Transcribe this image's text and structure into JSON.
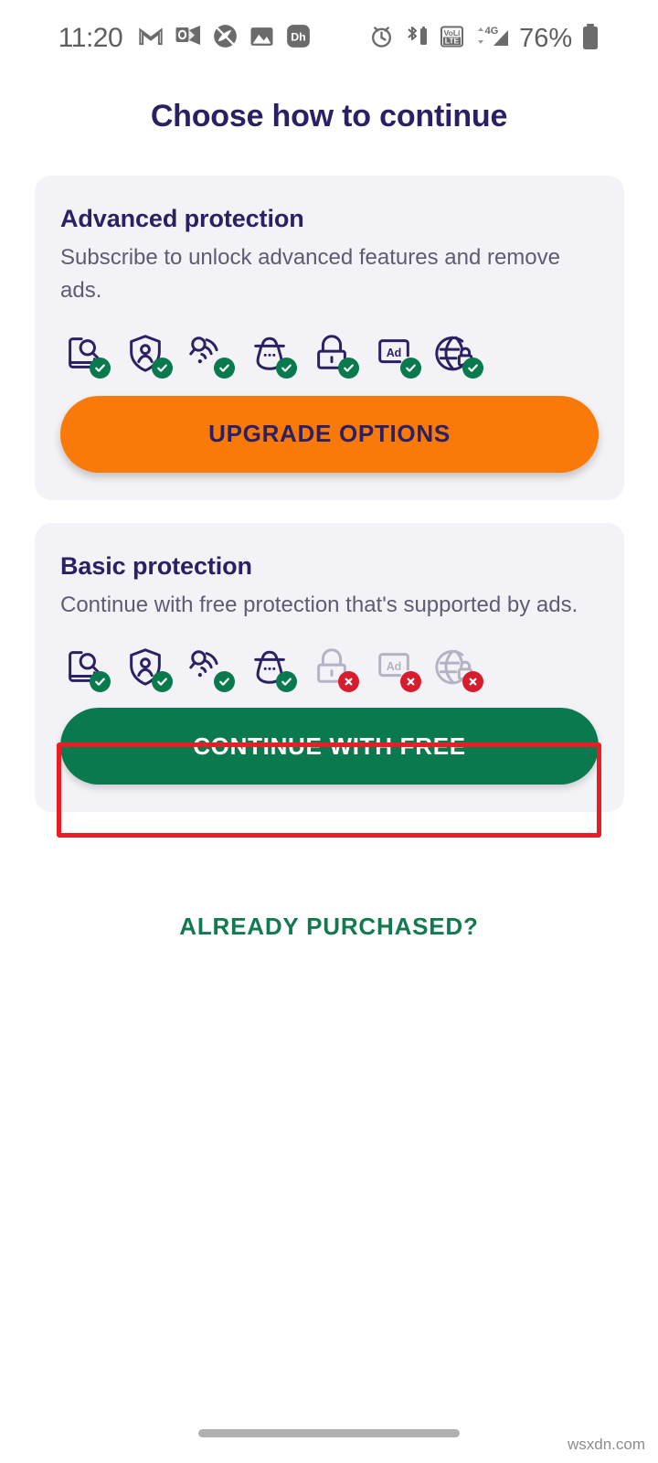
{
  "status_bar": {
    "time": "11:20",
    "battery_percent": "76%",
    "left_icons": [
      {
        "name": "gmail-icon",
        "label": "M"
      },
      {
        "name": "outlook-icon",
        "label": "Outlook"
      },
      {
        "name": "circle-app-icon",
        "label": "App"
      },
      {
        "name": "photos-icon",
        "label": "Photos"
      },
      {
        "name": "hotstar-icon",
        "label": "Dh"
      }
    ],
    "right_icons": [
      {
        "name": "alarm-icon",
        "label": "Alarm"
      },
      {
        "name": "bluetooth-battery-icon",
        "label": "Bluetooth"
      },
      {
        "name": "volte-icon",
        "label": "VoLTE"
      },
      {
        "name": "signal-4g-icon",
        "label": "4G"
      },
      {
        "name": "battery-icon",
        "label": "Battery"
      }
    ]
  },
  "header": {
    "title": "Choose how to continue"
  },
  "cards": [
    {
      "id": "advanced",
      "title": "Advanced protection",
      "description": "Subscribe to unlock advanced features and remove ads.",
      "features": [
        {
          "name": "phone-scan-icon",
          "label": "Device scan",
          "enabled": true
        },
        {
          "name": "shield-identity-icon",
          "label": "Identity protection",
          "enabled": true
        },
        {
          "name": "wifi-scan-icon",
          "label": "Wi-Fi scan",
          "enabled": true
        },
        {
          "name": "spy-detective-icon",
          "label": "Anti-spy",
          "enabled": true
        },
        {
          "name": "lock-icon",
          "label": "App lock",
          "enabled": true
        },
        {
          "name": "ad-block-icon",
          "label": "Ad removal",
          "enabled": true
        },
        {
          "name": "vpn-globe-lock-icon",
          "label": "VPN",
          "enabled": true
        }
      ],
      "button": {
        "name": "upgrade-options-button",
        "label": "UPGRADE OPTIONS",
        "color": "#F97A09",
        "text_color": "#2B2064"
      }
    },
    {
      "id": "basic",
      "title": "Basic protection",
      "description": "Continue with free protection that's supported by ads.",
      "features": [
        {
          "name": "phone-scan-icon",
          "label": "Device scan",
          "enabled": true
        },
        {
          "name": "shield-identity-icon",
          "label": "Identity protection",
          "enabled": true
        },
        {
          "name": "wifi-scan-icon",
          "label": "Wi-Fi scan",
          "enabled": true
        },
        {
          "name": "spy-detective-icon",
          "label": "Anti-spy",
          "enabled": true
        },
        {
          "name": "lock-icon",
          "label": "App lock",
          "enabled": false
        },
        {
          "name": "ad-block-icon",
          "label": "Ad removal",
          "enabled": false
        },
        {
          "name": "vpn-globe-lock-icon",
          "label": "VPN",
          "enabled": false
        }
      ],
      "button": {
        "name": "continue-with-free-button",
        "label": "CONTINUE WITH FREE",
        "color": "#0A7A4E",
        "text_color": "#FFFFFF"
      }
    }
  ],
  "already_purchased": {
    "label": "ALREADY PURCHASED?",
    "color": "#13794F"
  },
  "highlight": {
    "target": "continue-with-free-button",
    "color": "#EC1C24"
  },
  "watermark": {
    "text": "wsxdn.com"
  },
  "theme": {
    "page_background": "#FFFFFF",
    "card_background": "#F3F3F7",
    "primary_text": "#2B2064",
    "secondary_text": "#5C5C72",
    "icon_enabled": "#2B2064",
    "icon_disabled": "#B3B3C4",
    "badge_ok": "#087A4D",
    "badge_no": "#D81B2D"
  }
}
